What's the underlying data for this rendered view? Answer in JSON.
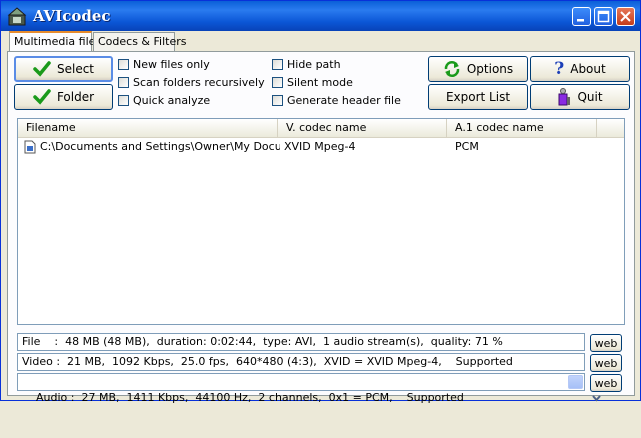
{
  "window": {
    "title": "AVIcodec"
  },
  "tabs": [
    {
      "label": "Multimedia files"
    },
    {
      "label": "Codecs & Filters"
    }
  ],
  "buttons": {
    "select": {
      "label": "Select",
      "accel": "S"
    },
    "folder": {
      "label": "Folder",
      "accel": "F"
    },
    "options": {
      "label": "Options",
      "accel": "O"
    },
    "about": {
      "label": "About",
      "accel": "A"
    },
    "export_list": {
      "label": "Export List"
    },
    "quit": {
      "label": "Quit",
      "accel": "Q"
    }
  },
  "options_col1": [
    {
      "label": "New files only",
      "checked": false
    },
    {
      "label": "Scan folders recursively",
      "checked": false
    },
    {
      "label": "Quick analyze",
      "checked": false
    }
  ],
  "options_col2": [
    {
      "label": "Hide path",
      "checked": false
    },
    {
      "label": "Silent mode",
      "checked": false
    },
    {
      "label": "Generate header file",
      "checked": false
    }
  ],
  "file_list": {
    "columns": [
      "Filename",
      "V. codec name",
      "A.1 codec name"
    ],
    "rows": [
      {
        "filename": "C:\\Documents and Settings\\Owner\\My Docum...",
        "vcodec": "XVID Mpeg-4",
        "acodec": "PCM"
      }
    ]
  },
  "info": {
    "file": "File    :  48 MB (48 MB),  duration: 0:02:44,  type: AVI,  1 audio stream(s),  quality: 71 %",
    "video": "Video :  21 MB,  1092 Kbps,  25.0 fps,  640*480 (4:3),  XVID = XVID Mpeg-4,    Supported",
    "audio": "Audio :  27 MB,  1411 Kbps,  44100 Hz,  2 channels,  0x1 = PCM,    Supported",
    "web_label": "web"
  },
  "colors": {
    "titlebar": "#0a5fd8",
    "check_green": "#1a9a1a",
    "tab_accent": "#e68b2c"
  }
}
